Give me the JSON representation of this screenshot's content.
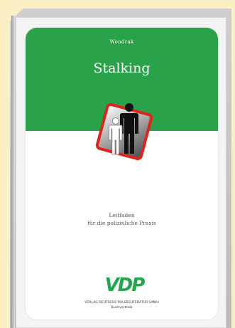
{
  "book": {
    "author": "Wondrak",
    "title": "Stalking",
    "subtitle_line1": "Leitfaden",
    "subtitle_line2": "für die polizeiliche Praxis",
    "publisher_line1": "VERLAG DEUTSCHE POLIZEILITERATUR GMBH",
    "publisher_line2": "Buchvertrieb",
    "logo_text": "VDP"
  },
  "colors": {
    "page_background": "#fbf0c4",
    "cover_green": "#2aa24a",
    "frame_red": "#e0231b",
    "logo_green": "#1fa84a"
  },
  "icons": {
    "cover_illustration": "two-person-figures-icon",
    "publisher_logo": "vdp-logo-icon"
  }
}
